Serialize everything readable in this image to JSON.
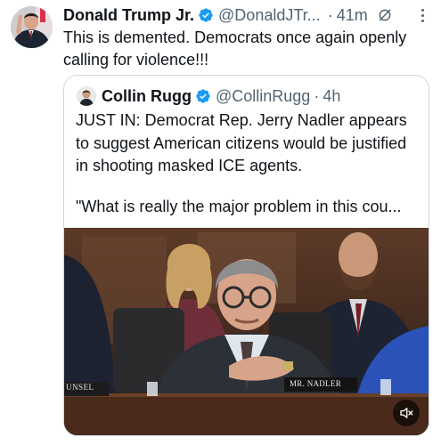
{
  "post": {
    "author_name": "Donald Trump Jr.",
    "author_handle": "@DonaldJTr...",
    "separator": "·",
    "timestamp": "41m",
    "text": "This is demented. Democrats once again openly calling for violence!!!"
  },
  "quote": {
    "author_name": "Collin Rugg",
    "author_handle": "@CollinRugg",
    "separator": "·",
    "timestamp": "4h",
    "text": "JUST IN: Democrat Rep. Jerry Nadler appears to suggest American citizens would be justified in shooting masked ICE agents.",
    "text_continued": "\"What is really the major problem in this cou...",
    "video": {
      "lower_left_label": "UNSEL",
      "nameplate": "MR. NADLER"
    }
  },
  "colors": {
    "verified": "#1d9bf0",
    "muted_text": "#536471",
    "border": "#cfd9de"
  },
  "icons": [
    "verified-badge-icon",
    "grok-icon",
    "more-icon",
    "mute-icon"
  ]
}
